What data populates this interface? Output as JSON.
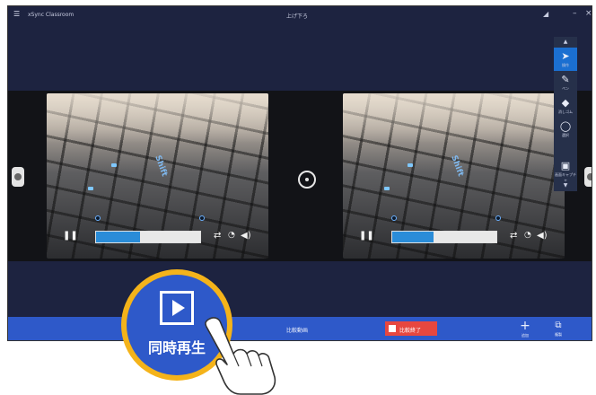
{
  "titlebar": {
    "menu_icon": "hamburger-menu-icon",
    "app_title": "xSync Classroom",
    "center_title": "上げ下ろ",
    "icons": [
      "wifi-icon",
      "minimize-icon",
      "close-icon"
    ]
  },
  "videos": [
    {
      "key_label": "Shift",
      "progress": 0.42
    },
    {
      "key_label": "Shift",
      "progress": 0.4
    }
  ],
  "toolbar": {
    "items": [
      {
        "label": "操作",
        "icon": "cursor-icon"
      },
      {
        "label": "ペン",
        "icon": "pen-icon"
      },
      {
        "label": "消しゴム",
        "icon": "eraser-icon"
      },
      {
        "label": "選択",
        "icon": "lasso-icon"
      },
      {
        "label": "画面キャプチャ",
        "icon": "camera-icon"
      }
    ]
  },
  "bottombar": {
    "compare_label": "比較動画",
    "end_label": "比較終了",
    "add_label": "追加",
    "copy_label": "複製"
  },
  "callout": {
    "label": "同時再生"
  },
  "colors": {
    "app_background": "#1d2340",
    "bottom_bar": "#2e59c9",
    "end_button": "#e7473f",
    "callout_ring": "#f4b31a",
    "progress_fill": "#2a8cd8"
  }
}
